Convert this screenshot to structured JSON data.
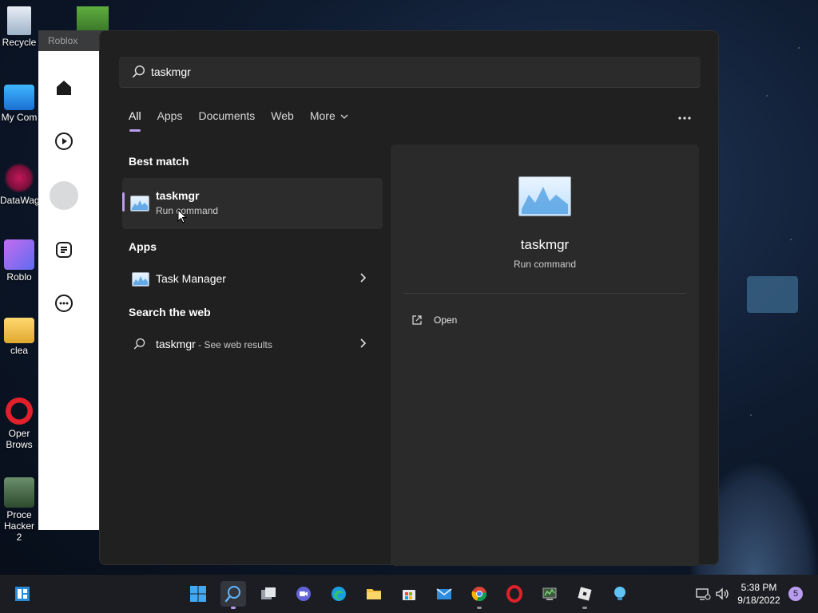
{
  "desktop": {
    "icons": [
      {
        "label": "Recycle"
      },
      {
        "label": "My Com"
      },
      {
        "label": "DataWag"
      },
      {
        "label": "Roblo"
      },
      {
        "label": "clea"
      },
      {
        "label": "Oper Brows"
      },
      {
        "label": "Proce Hacker 2"
      }
    ]
  },
  "roblox": {
    "title": "Roblox"
  },
  "search": {
    "query": "taskmgr",
    "tabs": [
      "All",
      "Apps",
      "Documents",
      "Web",
      "More"
    ],
    "active_tab": "All",
    "best_match_heading": "Best match",
    "best_match": {
      "title": "taskmgr",
      "subtitle": "Run command"
    },
    "apps_heading": "Apps",
    "apps": [
      {
        "label": "Task Manager"
      }
    ],
    "web_heading": "Search the web",
    "web_result": {
      "label": "taskmgr",
      "suffix": " - See web results"
    },
    "preview": {
      "title": "taskmgr",
      "subtitle": "Run command",
      "action_open": "Open"
    }
  },
  "taskbar": {
    "time": "5:38 PM",
    "date": "9/18/2022",
    "notification_count": "5",
    "pinned_icons": [
      "start-icon",
      "search-icon",
      "task-view-icon",
      "chat-icon",
      "edge-icon",
      "file-explorer-icon",
      "store-icon",
      "mail-icon",
      "chrome-icon",
      "opera-icon",
      "process-hacker-icon",
      "roblox-icon",
      "tips-icon"
    ]
  },
  "colors": {
    "accent": "#b99cf0",
    "panel_bg": "#202020",
    "preview_bg": "#2a2a2a",
    "taskbar_bg": "#1c1d22"
  }
}
